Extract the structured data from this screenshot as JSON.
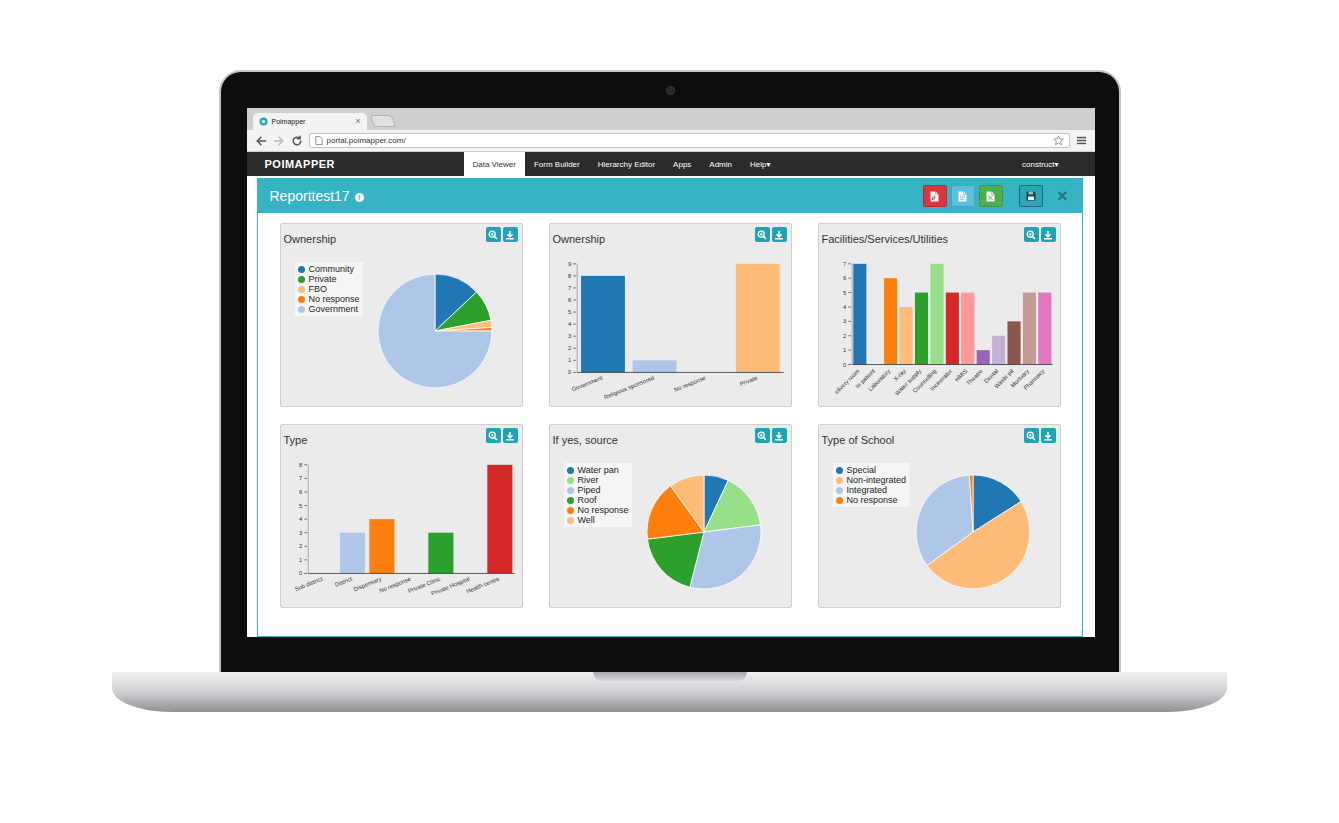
{
  "browser": {
    "tab": {
      "title": "Poimapper",
      "close": "×"
    },
    "nav_buttons": [
      {
        "kind": "back",
        "disabled": false
      },
      {
        "kind": "forward",
        "disabled": true
      },
      {
        "kind": "reload",
        "disabled": false
      }
    ],
    "address": "portal.poimapper.com/"
  },
  "navbar": {
    "logo": "POIMAPPER",
    "items": [
      {
        "label": "Data Viewer",
        "selected": true
      },
      {
        "label": "Form Builder",
        "selected": false
      },
      {
        "label": "Hierarchy Editor",
        "selected": false
      },
      {
        "label": "Apps",
        "selected": false
      },
      {
        "label": "Admin",
        "selected": false
      },
      {
        "label": "Help▾",
        "selected": false
      }
    ],
    "user": "construct▾"
  },
  "report": {
    "title": "Reporttest17",
    "info_icon": "i",
    "close": "×",
    "export_buttons": [
      {
        "kind": "pdf",
        "color": "#d9363e"
      },
      {
        "kind": "doc",
        "color": "#5bc0de"
      },
      {
        "kind": "xls",
        "color": "#4cae4c"
      }
    ]
  },
  "charts": [
    {
      "title": "Ownership",
      "kind": "pie",
      "slices": [
        {
          "label": "Community",
          "value": 13,
          "color": "#1f77b4"
        },
        {
          "label": "Private",
          "value": 9,
          "color": "#2ca02c"
        },
        {
          "label": "FBO",
          "value": 2,
          "color": "#ffbb78"
        },
        {
          "label": "No response",
          "value": 1,
          "color": "#ff7f0e"
        },
        {
          "label": "Government",
          "value": 75,
          "color": "#aec7e8"
        }
      ]
    },
    {
      "title": "Ownership",
      "kind": "bar",
      "ticks": [
        "0",
        "1",
        "2",
        "3",
        "4",
        "5",
        "6",
        "7",
        "8",
        "9"
      ],
      "bars": [
        {
          "label": "Government",
          "value": 8,
          "color": "#1f77b4"
        },
        {
          "label": "Religious sponsored",
          "value": 1,
          "color": "#aec7e8"
        },
        {
          "label": "No response",
          "value": 0,
          "color": "#ff7f0e"
        },
        {
          "label": "Private",
          "value": 9,
          "color": "#ffbb78"
        }
      ]
    },
    {
      "title": "Facilities/Services/Utilities",
      "kind": "bar",
      "ticks": [
        "0",
        "1",
        "2",
        "3",
        "4",
        "5",
        "6",
        "7"
      ],
      "bars": [
        {
          "label": "elivery room",
          "value": 7,
          "color": "#1f77b4"
        },
        {
          "label": "In patient",
          "value": 0,
          "color": "#aec7e8"
        },
        {
          "label": "Laboratory",
          "value": 6,
          "color": "#ff7f0e"
        },
        {
          "label": "X-ray",
          "value": 4,
          "color": "#ffbb78"
        },
        {
          "label": "Water supply",
          "value": 5,
          "color": "#2ca02c"
        },
        {
          "label": "Counselling",
          "value": 7,
          "color": "#98df8a"
        },
        {
          "label": "Incinerator",
          "value": 5,
          "color": "#d62728"
        },
        {
          "label": "HMIS",
          "value": 5,
          "color": "#ff9896"
        },
        {
          "label": "Theatre",
          "value": 1,
          "color": "#9467bd"
        },
        {
          "label": "Dental",
          "value": 2,
          "color": "#c5b0d5"
        },
        {
          "label": "Waste pit",
          "value": 3,
          "color": "#8c564b"
        },
        {
          "label": "Mortuary",
          "value": 5,
          "color": "#c49c94"
        },
        {
          "label": "Pharmacy",
          "value": 5,
          "color": "#e377c2"
        }
      ]
    },
    {
      "title": "Type",
      "kind": "bar",
      "ticks": [
        "0",
        "1",
        "2",
        "3",
        "4",
        "5",
        "6",
        "7",
        "8"
      ],
      "bars": [
        {
          "label": "Sub district",
          "value": 0,
          "color": "#1f77b4"
        },
        {
          "label": "District",
          "value": 3,
          "color": "#aec7e8"
        },
        {
          "label": "Dispensary",
          "value": 4,
          "color": "#ff7f0e"
        },
        {
          "label": "No response",
          "value": 0,
          "color": "#ffbb78"
        },
        {
          "label": "Private Clinic",
          "value": 3,
          "color": "#2ca02c"
        },
        {
          "label": "Private Hospital",
          "value": 0,
          "color": "#98df8a"
        },
        {
          "label": "Health centre",
          "value": 8,
          "color": "#d62728"
        }
      ]
    },
    {
      "title": "If yes, source",
      "kind": "pie",
      "slices": [
        {
          "label": "Water pan",
          "value": 7,
          "color": "#1f77b4"
        },
        {
          "label": "River",
          "value": 16,
          "color": "#98df8a"
        },
        {
          "label": "Piped",
          "value": 31,
          "color": "#aec7e8"
        },
        {
          "label": "Roof",
          "value": 19,
          "color": "#2ca02c"
        },
        {
          "label": "No response",
          "value": 17,
          "color": "#ff7f0e"
        },
        {
          "label": "Well",
          "value": 10,
          "color": "#ffbb78"
        }
      ]
    },
    {
      "title": "Type of School",
      "kind": "pie",
      "slices": [
        {
          "label": "Special",
          "value": 16,
          "color": "#1f77b4"
        },
        {
          "label": "Non-integrated",
          "value": 49,
          "color": "#ffbb78"
        },
        {
          "label": "Integrated",
          "value": 34,
          "color": "#aec7e8"
        },
        {
          "label": "No response",
          "value": 1,
          "color": "#ff7f0e"
        }
      ]
    }
  ]
}
